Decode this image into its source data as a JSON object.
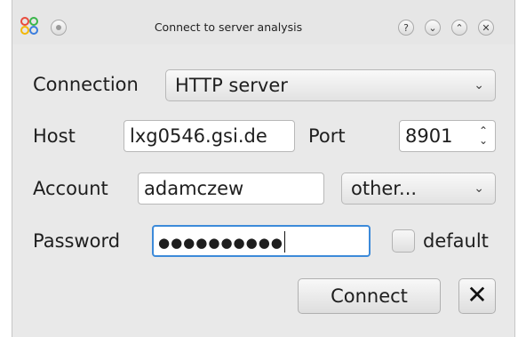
{
  "window": {
    "title": "Connect to server analysis",
    "titlebar_buttons": [
      {
        "name": "help-icon",
        "glyph": "?"
      },
      {
        "name": "minimize-icon",
        "glyph": "⌄"
      },
      {
        "name": "maximize-icon",
        "glyph": "⌃"
      },
      {
        "name": "close-icon",
        "glyph": "✕"
      }
    ],
    "menu_button_icon": "circle-menu-icon",
    "app_icon": "app-logo-icon"
  },
  "form": {
    "connection": {
      "label": "Connection",
      "value": "HTTP server",
      "arrow": "⌄"
    },
    "host": {
      "label": "Host",
      "value": "lxg0546.gsi.de"
    },
    "port": {
      "label": "Port",
      "value": "8901",
      "arrows": "⌃⌄"
    },
    "account": {
      "label": "Account",
      "value": "adamczew",
      "type_value": "other...",
      "arrow": "⌄"
    },
    "password": {
      "label": "Password",
      "value": "●●●●●●●●●●",
      "default_label": "default",
      "default_checked": false
    }
  },
  "actions": {
    "connect_label": "Connect",
    "cancel_glyph": "✕"
  },
  "colors": {
    "focus_border": "#3c8ad9",
    "window_bg": "#e9e9e9"
  }
}
